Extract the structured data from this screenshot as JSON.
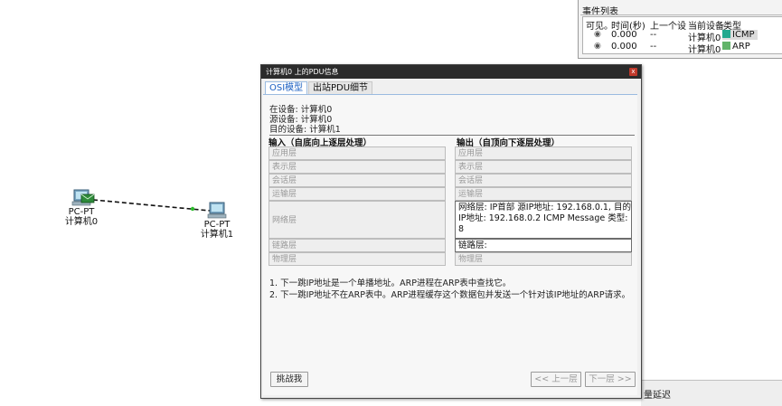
{
  "workspace": {
    "devices": [
      {
        "type": "PC-PT",
        "name": "计算机0"
      },
      {
        "type": "PC-PT",
        "name": "计算机1"
      }
    ]
  },
  "event_list": {
    "title": "事件列表",
    "columns": [
      "可见。",
      "时间(秒)",
      "上一个设",
      "当前设备",
      "类型"
    ],
    "rows": [
      {
        "time": "0.000",
        "last": "--",
        "current": "计算机0",
        "type": "ICMP",
        "color": "#23a98f"
      },
      {
        "time": "0.000",
        "last": "--",
        "current": "计算机0",
        "type": "ARP",
        "color": "#62b46a"
      }
    ]
  },
  "bottom_strip": {
    "label": "量延迟"
  },
  "dialog": {
    "title": "计算机0 上的PDU信息",
    "close_glyph": "x",
    "tabs": [
      {
        "label": "OSI模型",
        "active": true
      },
      {
        "label": "出站PDU细节",
        "active": false
      }
    ],
    "info": {
      "at_device": "在设备: 计算机0",
      "source": "源设备: 计算机0",
      "dest": "目的设备: 计算机1"
    },
    "in_heading": "输入（自底向上逐层处理）",
    "out_heading": "输出（自顶向下逐层处理）",
    "in_layers": [
      "应用层",
      "表示层",
      "会话层",
      "运输层",
      "网络层",
      "链路层",
      "物理层"
    ],
    "out_layers": [
      "应用层",
      "表示层",
      "会话层",
      "运输层",
      "网络层: IP首部 源IP地址: 192.168.0.1, 目的IP地址: 192.168.0.2 ICMP Message 类型: 8",
      "链路层:",
      "物理层"
    ],
    "notes": [
      "1. 下一跳IP地址是一个单播地址。ARP进程在ARP表中查找它。",
      "2. 下一跳IP地址不在ARP表中。ARP进程缓存这个数据包并发送一个针对该IP地址的ARP请求。"
    ],
    "buttons": {
      "challenge": "挑战我",
      "prev": "<< 上一层",
      "next": "下一层 >>"
    },
    "colors": {
      "accent": "#1a5fc2",
      "titlebar": "#2b2b2b"
    }
  }
}
